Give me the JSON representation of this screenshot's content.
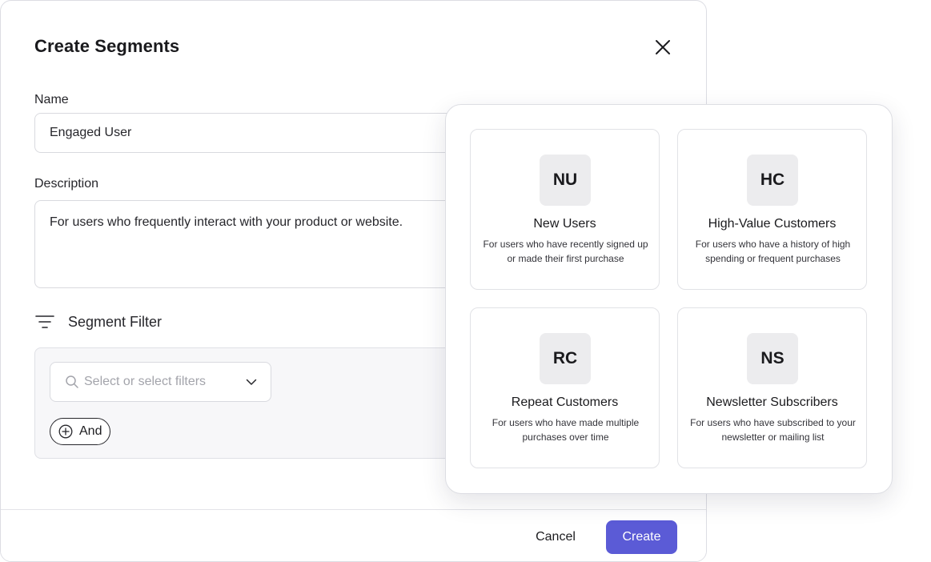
{
  "modal": {
    "title": "Create Segments",
    "name_label": "Name",
    "name_value": "Engaged User",
    "description_label": "Description",
    "description_value": "For users who frequently interact with your product or website.",
    "filter_title": "Segment Filter",
    "select_placeholder": "Select or select filters",
    "and_label": "And",
    "cancel_label": "Cancel",
    "create_label": "Create",
    "accent_color": "#5b5bd6"
  },
  "segments": [
    {
      "initials": "NU",
      "title": "New Users",
      "description": "For users who have recently signed up or made their first purchase"
    },
    {
      "initials": "HC",
      "title": "High-Value Customers",
      "description": "For users who have a history of high spending or frequent purchases"
    },
    {
      "initials": "RC",
      "title": "Repeat Customers",
      "description": "For users who have made multiple purchases over time"
    },
    {
      "initials": "NS",
      "title": "Newsletter Subscribers",
      "description": "For users who have subscribed to your newsletter or mailing list"
    }
  ]
}
